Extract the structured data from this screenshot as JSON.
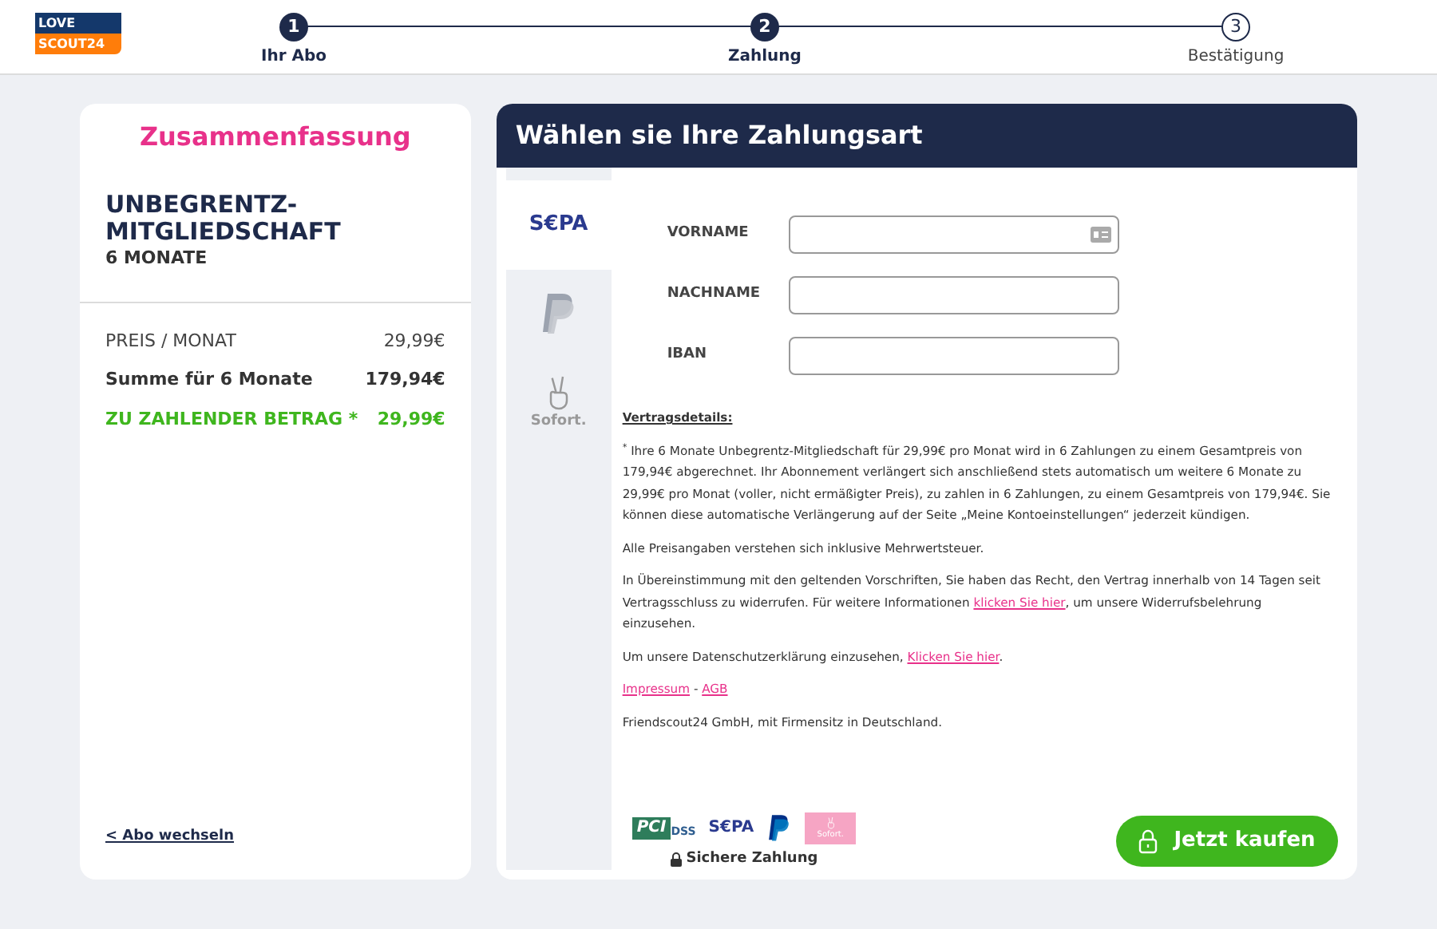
{
  "logo": {
    "top": "LOVE",
    "bottom": "SCOUT24"
  },
  "steps": [
    {
      "number": "1",
      "label": "Ihr Abo",
      "done": true
    },
    {
      "number": "2",
      "label": "Zahlung",
      "done": true
    },
    {
      "number": "3",
      "label": "Bestätigung",
      "done": false
    }
  ],
  "summary": {
    "title": "Zusammenfassung",
    "product": "UNBEGRENTZ-MITGLIEDSCHAFT",
    "duration": "6 MONATE",
    "rows": [
      {
        "kind": "plain",
        "label": "PREIS / MONAT",
        "value": "29,99€"
      },
      {
        "kind": "bold",
        "label": "Summe für 6 Monate",
        "value": "179,94€"
      },
      {
        "kind": "highlight",
        "label": "ZU ZAHLENDER BETRAG *",
        "value": "29,99€"
      }
    ],
    "change_link": "< Abo wechseln"
  },
  "payment": {
    "title": "Wählen sie Ihre Zahlungsart",
    "methods": [
      {
        "kind": "sepa",
        "label": "S€PA",
        "selected": true
      },
      {
        "kind": "paypal",
        "selected": false
      },
      {
        "kind": "sofort",
        "label": "Sofort.",
        "selected": false
      }
    ],
    "fields": [
      {
        "label": "VORNAME",
        "autofill_icon": true
      },
      {
        "label": "NACHNAME",
        "autofill_icon": false
      },
      {
        "label": "IBAN",
        "autofill_icon": false
      }
    ],
    "details_heading": "Vertragsdetails:",
    "paragraphs": [
      [
        {
          "kind": "text",
          "text": "$^{*}$ Ihre 6 Monate Unbegrentz-Mitgliedschaft für 29,99€ pro Monat wird in 6 Zahlungen zu einem Gesamtpreis von 179,94€ abgerechnet. Ihr Abonnement verlängert sich anschließend stets automatisch um weitere 6 Monate zu 29,99€ pro Monat (voller, nicht ermäßigter Preis), zu zahlen in 6 Zahlungen, zu einem Gesamtpreis von 179,94€. Sie können diese automatische Verlängerung auf der Seite „Meine Kontoeinstellungen“ jederzeit kündigen."
        }
      ],
      [
        {
          "kind": "text",
          "text": "Alle Preisangaben verstehen sich inklusive Mehrwertsteuer."
        }
      ],
      [
        {
          "kind": "text",
          "text": "In Übereinstimmung mit den geltenden Vorschriften, Sie haben das Recht, den Vertrag innerhalb von 14 Tagen seit Vertragsschluss zu widerrufen. Für weitere Informationen "
        },
        {
          "kind": "link",
          "text": "klicken Sie hier"
        },
        {
          "kind": "text",
          "text": ", um unsere Widerrufsbelehrung einzusehen."
        }
      ],
      [
        {
          "kind": "text",
          "text": "Um unsere Datenschutzerklärung einzusehen, "
        },
        {
          "kind": "link",
          "text": "Klicken Sie hier"
        },
        {
          "kind": "text",
          "text": "."
        }
      ],
      [
        {
          "kind": "link",
          "text": "Impressum"
        },
        {
          "kind": "text",
          "text": " - "
        },
        {
          "kind": "link",
          "text": "AGB"
        }
      ],
      [
        {
          "kind": "text",
          "text": "Friendscout24 GmbH, mit Firmensitz in Deutschland."
        }
      ]
    ],
    "badges": [
      {
        "kind": "pci",
        "text": "PCI",
        "sub": "DSS"
      },
      {
        "kind": "sepa",
        "text": "S€PA"
      },
      {
        "kind": "paypal"
      },
      {
        "kind": "sofort",
        "text": "Sofort."
      }
    ],
    "secure_label": "Sichere Zahlung",
    "buy_button": "Jetzt kaufen"
  }
}
